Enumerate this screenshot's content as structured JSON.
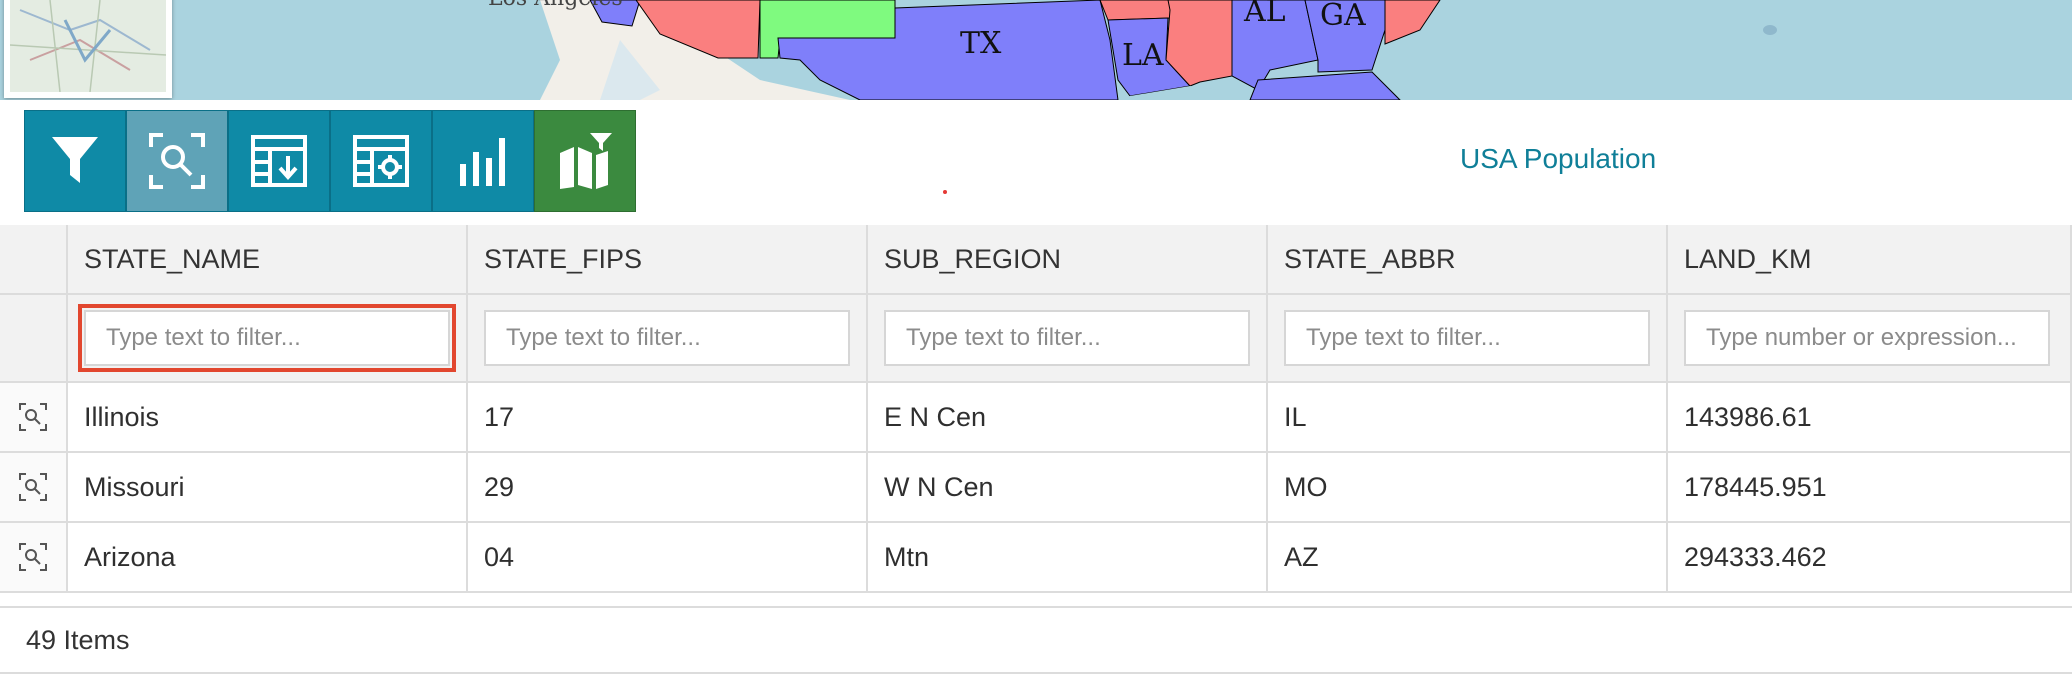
{
  "map": {
    "labels": [
      "TX",
      "LA",
      "AL",
      "GA",
      "Los Angeles"
    ],
    "colors": {
      "red": "#fa7f7f",
      "green": "#7ffa7f",
      "blue": "#7f7ffa",
      "water": "#aad3df",
      "land": "#f2efe9"
    }
  },
  "toolbar": {
    "buttons": [
      {
        "icon": "filter-icon",
        "state": "normal"
      },
      {
        "icon": "zoom-to-icon",
        "state": "active"
      },
      {
        "icon": "table-export-icon",
        "state": "normal"
      },
      {
        "icon": "table-settings-icon",
        "state": "normal"
      },
      {
        "icon": "bar-chart-icon",
        "state": "normal"
      },
      {
        "icon": "map-filter-icon",
        "state": "green"
      }
    ],
    "colors": {
      "primary": "#0f8aa6",
      "active": "#5fa3b7",
      "green": "#3b8a3f"
    }
  },
  "layer_title": "USA Population",
  "grid": {
    "columns": [
      "STATE_NAME",
      "STATE_FIPS",
      "SUB_REGION",
      "STATE_ABBR",
      "LAND_KM"
    ],
    "filters": [
      "Type text to filter...",
      "Type text to filter...",
      "Type text to filter...",
      "Type text to filter...",
      "Type number or expression..."
    ],
    "rows": [
      {
        "state_name": "Illinois",
        "state_fips": "17",
        "sub_region": "E N Cen",
        "state_abbr": "IL",
        "land_km": "143986.61"
      },
      {
        "state_name": "Missouri",
        "state_fips": "29",
        "sub_region": "W N Cen",
        "state_abbr": "MO",
        "land_km": "178445.951"
      },
      {
        "state_name": "Arizona",
        "state_fips": "04",
        "sub_region": "Mtn",
        "state_abbr": "AZ",
        "land_km": "294333.462"
      }
    ],
    "focus_color": "#e2472f"
  },
  "footer": {
    "item_count": "49 Items"
  }
}
